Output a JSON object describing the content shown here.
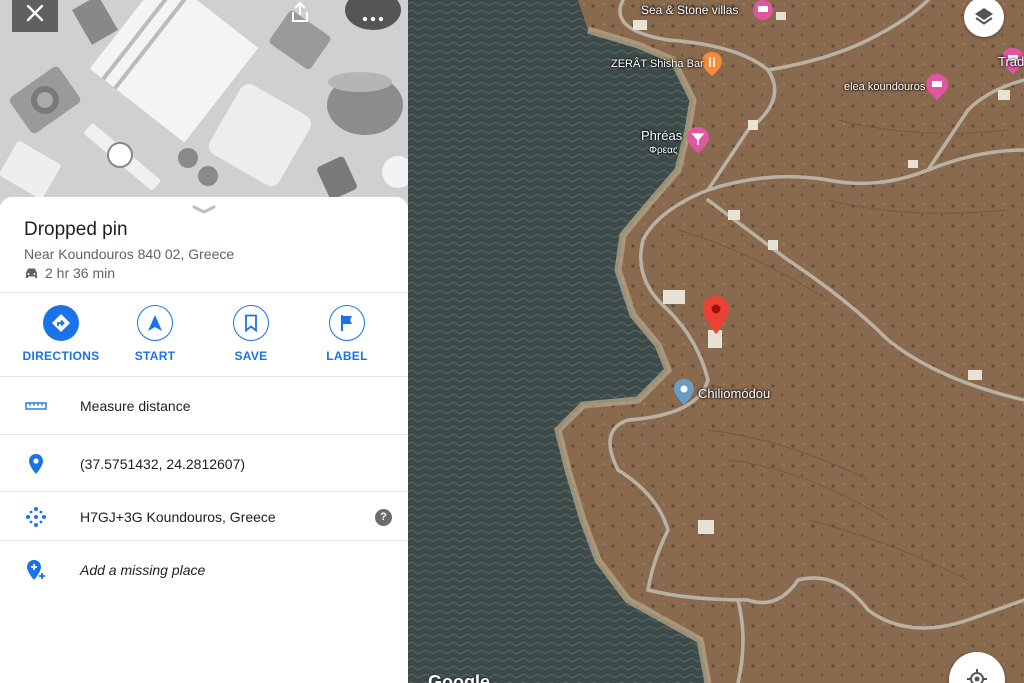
{
  "header": {
    "close_icon": "close-icon",
    "share_icon": "share-icon",
    "more_icon": "more-icon"
  },
  "place": {
    "title": "Dropped pin",
    "address": "Near Koundouros 840 02, Greece",
    "eta": "2 hr 36 min",
    "eta_icon": "car-icon"
  },
  "actions": [
    {
      "label": "DIRECTIONS",
      "icon": "directions-icon"
    },
    {
      "label": "START",
      "icon": "navigation-arrow-icon"
    },
    {
      "label": "SAVE",
      "icon": "bookmark-icon"
    },
    {
      "label": "LABEL",
      "icon": "flag-icon"
    }
  ],
  "rows": [
    {
      "text": "Measure distance",
      "icon": "ruler-icon"
    },
    {
      "text": "(37.5751432, 24.2812607)",
      "icon": "location-pin-icon"
    },
    {
      "text": "H7GJ+3G Koundouros, Greece",
      "icon": "plus-code-icon",
      "help": "?"
    },
    {
      "text": "Add a missing place",
      "icon": "add-location-icon"
    }
  ],
  "map": {
    "labels": {
      "sea_stone": "Sea & Stone villas",
      "zerat": "ZERÂT Shisha Bar",
      "phreas": "Phréas",
      "phreas_greek": "Φρεας",
      "elea": "elea koundouros",
      "trad": "Trad",
      "chiliomodou": "Chiliomódou"
    },
    "logo": "Google",
    "layers_icon": "layers-icon",
    "locate_icon": "my-location-icon"
  },
  "colors": {
    "accent": "#1a73e8",
    "pin_red": "#ea4335",
    "poi_pink": "#e056a0",
    "poi_orange": "#f28b3b",
    "poi_blue": "#5f8fb4"
  }
}
